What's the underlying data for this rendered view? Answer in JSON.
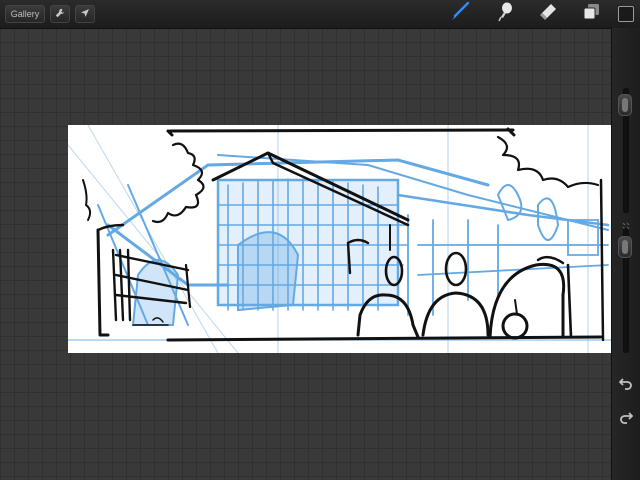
{
  "topbar": {
    "gallery_label": "Gallery",
    "actions_icon": "wrench-icon",
    "transform_icon": "arrow-cursor-icon",
    "tools": [
      "brush-icon",
      "smudge-icon",
      "eraser-icon",
      "layers-icon"
    ],
    "active_tool": "brush-icon",
    "active_color": "#1a1a1a",
    "accent": "#2e8bff"
  },
  "sidebar": {
    "brush_size_level": 0.06,
    "opacity_level": 0.08,
    "undo_icon": "undo-icon",
    "redo_icon": "redo-icon"
  },
  "canvas": {
    "sketch_colors": {
      "underdrawing": "#4a9ae0",
      "ink": "#111111"
    }
  }
}
